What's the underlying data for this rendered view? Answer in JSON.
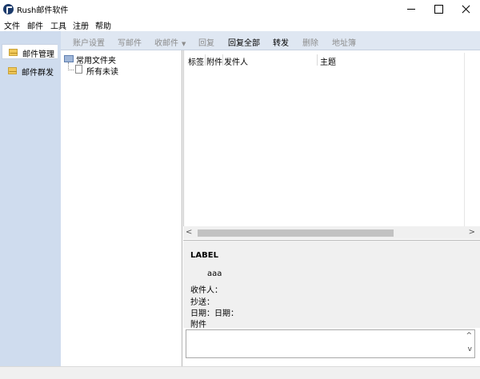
{
  "window": {
    "title": "Rush邮件软件"
  },
  "menu": [
    "文件",
    "邮件",
    "工具",
    "注册",
    "帮助"
  ],
  "nav": {
    "items": [
      {
        "label": "邮件管理",
        "active": true,
        "icon": "envelope-icon"
      },
      {
        "label": "邮件群发",
        "active": false,
        "icon": "envelope-icon"
      }
    ]
  },
  "toolbar": {
    "items": [
      {
        "label": "账户设置",
        "enabled": false
      },
      {
        "label": "写邮件",
        "enabled": false
      },
      {
        "label": "收邮件",
        "enabled": false,
        "caret": "▼"
      },
      {
        "label": "回复",
        "enabled": false
      },
      {
        "label": "回复全部",
        "enabled": true
      },
      {
        "label": "转发",
        "enabled": true
      },
      {
        "label": "删除",
        "enabled": false
      },
      {
        "label": "地址簿",
        "enabled": false
      }
    ]
  },
  "tree": {
    "root": "常用文件夹",
    "children": [
      "所有未读"
    ]
  },
  "message_list": {
    "columns": [
      "标签",
      "附件",
      "发件人",
      "主题"
    ]
  },
  "scroll": {
    "left_arrow": "<",
    "right_arrow": ">",
    "up_arrow": "^",
    "down_arrow": "v"
  },
  "preview": {
    "label": "LABEL",
    "body": "aaa",
    "to": "收件人：",
    "cc": "抄送：",
    "date": "日期：日期：",
    "attachment": "附件"
  },
  "colors": {
    "nav_bg": "#cfdcee",
    "toolbar_bg": "#dfe7f2",
    "disabled_text": "#8c8c8c"
  }
}
